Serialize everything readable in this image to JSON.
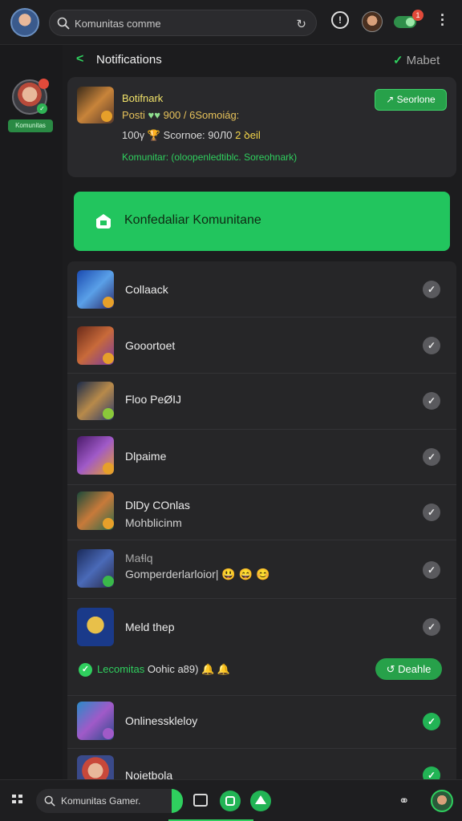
{
  "topbar": {
    "search_text": "Komunitas comme",
    "notif_count": "1",
    "icons": [
      "avatar",
      "search-icon",
      "refresh-icon",
      "info-icon",
      "user-avatar",
      "toggle",
      "kebab-menu-icon"
    ]
  },
  "rail": {
    "badge": "Komunitas"
  },
  "header": {
    "title": "Notifications",
    "right_label": "Mabet"
  },
  "profile": {
    "name": "Botifnark",
    "stats_a": "Posti",
    "stats_b": "900",
    "stats_c": "/ 6Somoiág:",
    "score_a": "100γ",
    "score_b": "Scornoe: 90Л0",
    "score_c": "2 ꝺeil",
    "description": "Komunitar: (oloopenledtiblc. Soreohnark)",
    "button_label": "Seorlone"
  },
  "banner": {
    "text": "Konfedaliar Komunitane"
  },
  "list": {
    "items": [
      {
        "label": "Collaack",
        "label2": "",
        "checked": false
      },
      {
        "label": "Gooortoet",
        "label2": "",
        "checked": false
      },
      {
        "label": "Floo PeØIJ",
        "label2": "",
        "checked": false
      },
      {
        "label": "Dlpaime",
        "label2": "",
        "checked": false
      },
      {
        "label": "DlDy COnlas",
        "label2": "Mohblicinm",
        "checked": false
      },
      {
        "label": "Maɬlq",
        "label2": "Gomperderlarloior| 😃 😄 😊",
        "checked": false
      },
      {
        "label": "Meld thep",
        "label2": "",
        "checked": false
      }
    ],
    "section": {
      "text": "Lecomitas",
      "text_b": "Oohic a89)",
      "button_label": "Deahle"
    },
    "items2": [
      {
        "label": "Onlinesskleloy",
        "checked": true
      },
      {
        "label": "Noietbola",
        "checked": true
      }
    ]
  },
  "bottombar": {
    "search_text": "Komunitas Gamer."
  }
}
